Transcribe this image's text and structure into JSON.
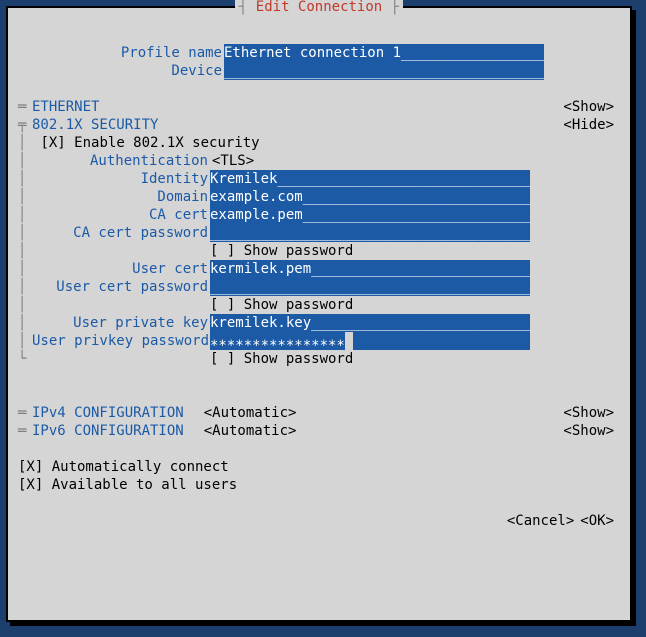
{
  "title": "Edit Connection",
  "fields": {
    "profile_name": {
      "label": "Profile name",
      "value": "Ethernet connection 1"
    },
    "device": {
      "label": "Device",
      "value": ""
    }
  },
  "sections": {
    "ethernet": {
      "label": "ETHERNET",
      "toggle": "<Show>",
      "marker": "═"
    },
    "secx": {
      "label": "802.1X SECURITY",
      "toggle": "<Hide>",
      "marker": "╤"
    },
    "ipv4": {
      "label": "IPv4 CONFIGURATION",
      "value": "<Automatic>",
      "toggle": "<Show>",
      "marker": "═"
    },
    "ipv6": {
      "label": "IPv6 CONFIGURATION",
      "value": "<Automatic>",
      "toggle": "<Show>",
      "marker": "═"
    }
  },
  "sec": {
    "enable_chk": "[X]",
    "enable_label": "Enable 802.1X security",
    "auth_label": "Authentication",
    "auth_value": "<TLS>",
    "identity_label": "Identity",
    "identity_value": "Kremilek",
    "domain_label": "Domain",
    "domain_value": "example.com",
    "ca_cert_label": "CA cert",
    "ca_cert_value": "example.pem",
    "ca_cert_pw_label": "CA cert password",
    "ca_cert_pw_value": "",
    "showpw1": "[ ] Show password",
    "user_cert_label": "User cert",
    "user_cert_value": "kermilek.pem",
    "user_cert_pw_label": "User cert password",
    "user_cert_pw_value": "",
    "showpw2": "[ ] Show password",
    "user_key_label": "User private key",
    "user_key_value": "kremilek.key",
    "user_key_pw_label": "User privkey password",
    "user_key_pw_value": "****************",
    "showpw3": "[ ] Show password",
    "tree_corner": "└"
  },
  "footer": {
    "auto_connect": "[X] Automatically connect",
    "all_users": "[X] Available to all users",
    "cancel": "<Cancel>",
    "ok": "<OK>"
  },
  "pad": "________________________________________"
}
